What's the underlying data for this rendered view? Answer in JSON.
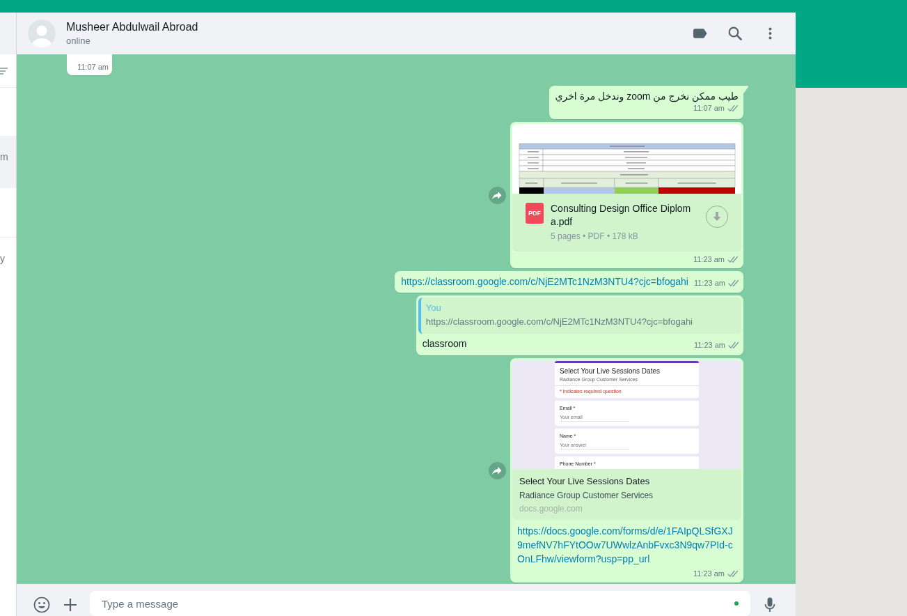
{
  "chat_list": {
    "items": [
      {
        "snippet": "m",
        "selected": true
      },
      {
        "snippet": "y",
        "selected": false
      }
    ]
  },
  "chat_header": {
    "name": "Musheer Abdulwail Abroad",
    "status": "online"
  },
  "messages": [
    {
      "kind": "time_only",
      "outgoing": false,
      "tail": false,
      "forward_button": false,
      "time": "11:07 am"
    },
    {
      "kind": "text",
      "outgoing": true,
      "tail": true,
      "forward_button": false,
      "text": "طيب ممكن نخرج من zoom وندخل مرة اخري",
      "time": "11:07 am",
      "read": false
    },
    {
      "kind": "document",
      "outgoing": true,
      "tail": false,
      "forward_button": true,
      "file_type": "PDF",
      "file_name": "Consulting Design Office Diploma.pdf",
      "details": "5 pages • PDF • 178 kB",
      "time": "11:23 am",
      "read": false
    },
    {
      "kind": "link",
      "outgoing": true,
      "tail": false,
      "forward_button": false,
      "link": "https://classroom.google.com/c/NjE2MTc1NzM3NTU4?cjc=bfogahi",
      "time": "11:23 am",
      "read": false
    },
    {
      "kind": "reply",
      "outgoing": true,
      "tail": false,
      "forward_button": false,
      "quote": {
        "author": "You",
        "text": "https://classroom.google.com/c/NjE2MTc1NzM3NTU4?cjc=bfogahi"
      },
      "text": "classroom",
      "time": "11:23 am",
      "read": false
    },
    {
      "kind": "link_preview",
      "outgoing": true,
      "tail": false,
      "forward_button": true,
      "form": {
        "title": "Select Your Live Sessions Dates",
        "subtitle": "Radiance Group Customer Services",
        "note": "* Indicates required question",
        "questions": [
          {
            "label": "Email *",
            "placeholder": "Your email"
          },
          {
            "label": "Name *",
            "placeholder": "Your answer"
          },
          {
            "label": "Phone Number *"
          }
        ]
      },
      "title": "Select Your Live Sessions Dates",
      "description": "Radiance Group Customer Services",
      "domain": "docs.google.com",
      "link": "https://docs.google.com/forms/d/e/1FAIpQLSfGXJ9mefNV7hFYtOOw7UWwlzAnbFvxc3N9qw7PId-cOnLFhw/viewform?usp=pp_url",
      "time": "11:23 am",
      "read": false
    }
  ],
  "composer": {
    "placeholder": "Type a message"
  }
}
